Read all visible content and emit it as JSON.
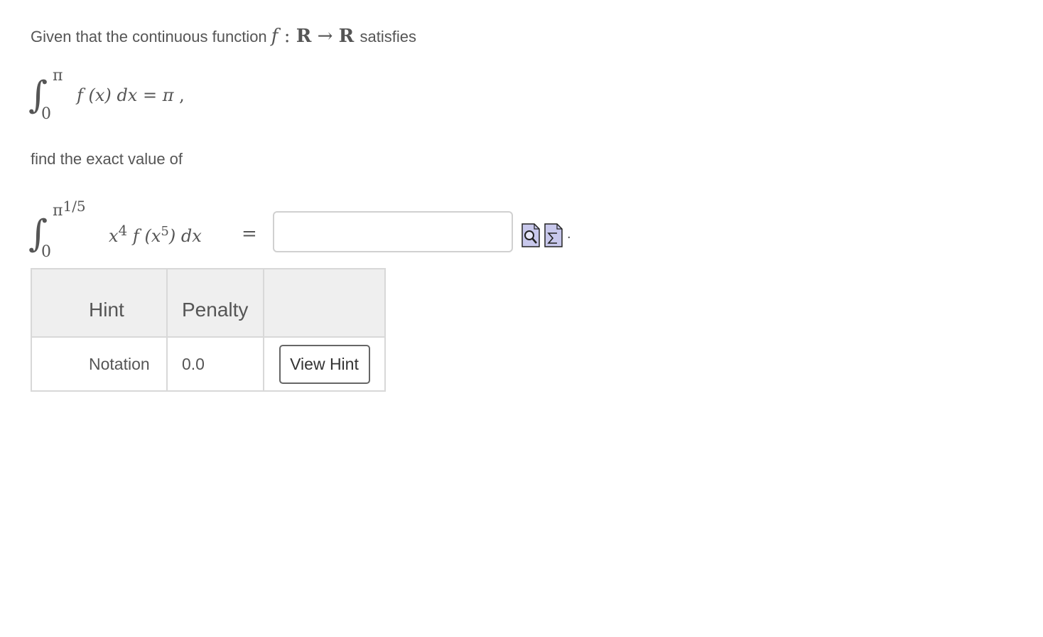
{
  "problem": {
    "intro": "Given that the continuous function",
    "func_f": "f",
    "func_colon": ":",
    "func_domain": "R",
    "func_arrow": "→",
    "func_codomain": "R",
    "intro_end": "satisfies",
    "integral1": {
      "upper": "π",
      "lower": "0",
      "integrand_f": "f",
      "integrand_arg": "(x)",
      "dx": "dx",
      "equals": "=",
      "value": "π",
      "comma": ","
    },
    "find_text": "find the exact value of",
    "integral2": {
      "upper_base": "π",
      "upper_exp": "1/5",
      "lower": "0",
      "x": "x",
      "x_exp": "4",
      "f": "f",
      "paren_open": "(x",
      "inner_exp": "5",
      "paren_close": ")",
      "dx": "dx",
      "equals": "="
    },
    "answer_value": "",
    "after_period": "."
  },
  "tools": {
    "preview_icon": "preview-icon",
    "equation_editor_icon": "equation-editor-icon"
  },
  "hints_table": {
    "headers": [
      "Hint",
      "Penalty",
      ""
    ],
    "rows": [
      {
        "hint": "Notation",
        "penalty": "0.0",
        "button": "View Hint"
      }
    ]
  }
}
